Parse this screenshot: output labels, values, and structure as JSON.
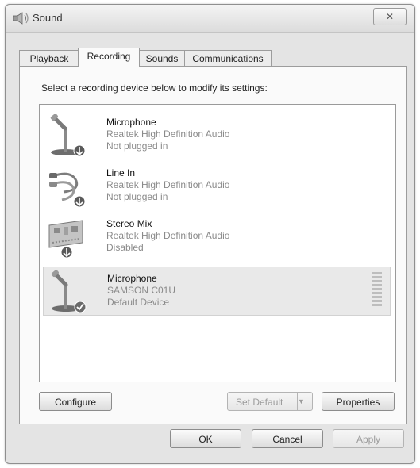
{
  "window": {
    "title": "Sound",
    "close_glyph": "✕"
  },
  "tabs": [
    {
      "label": "Playback"
    },
    {
      "label": "Recording",
      "active": true
    },
    {
      "label": "Sounds"
    },
    {
      "label": "Communications"
    }
  ],
  "instruction": "Select a recording device below to modify its settings:",
  "devices": [
    {
      "name": "Microphone",
      "driver": "Realtek High Definition Audio",
      "status": "Not plugged in",
      "icon": "microphone-icon",
      "badge": "down-arrow-badge"
    },
    {
      "name": "Line In",
      "driver": "Realtek High Definition Audio",
      "status": "Not plugged in",
      "icon": "line-in-cable-icon",
      "badge": "down-arrow-badge"
    },
    {
      "name": "Stereo Mix",
      "driver": "Realtek High Definition Audio",
      "status": "Disabled",
      "icon": "sound-card-icon",
      "badge": "down-arrow-badge"
    },
    {
      "name": "Microphone",
      "driver": "SAMSON C01U",
      "status": "Default Device",
      "icon": "microphone-icon",
      "badge": "check-badge",
      "selected": true
    }
  ],
  "buttons": {
    "configure": "Configure",
    "set_default": "Set Default",
    "set_default_arrow": "▼",
    "properties": "Properties",
    "ok": "OK",
    "cancel": "Cancel",
    "apply": "Apply"
  }
}
